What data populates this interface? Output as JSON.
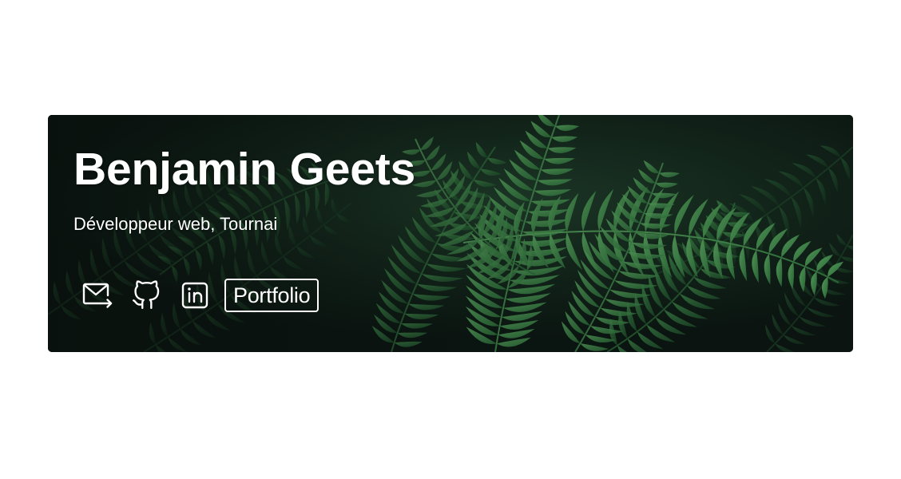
{
  "profile": {
    "name": "Benjamin Geets",
    "subtitle": "Développeur web, Tournai"
  },
  "links": {
    "email_icon": "mail-send-icon",
    "github_icon": "github-icon",
    "linkedin_icon": "linkedin-icon",
    "portfolio_label": "Portfolio"
  },
  "colors": {
    "page_background": "#ffffff",
    "card_dark": "#0f1c16",
    "fern_green": "#3f8f4a",
    "text": "#ffffff"
  }
}
